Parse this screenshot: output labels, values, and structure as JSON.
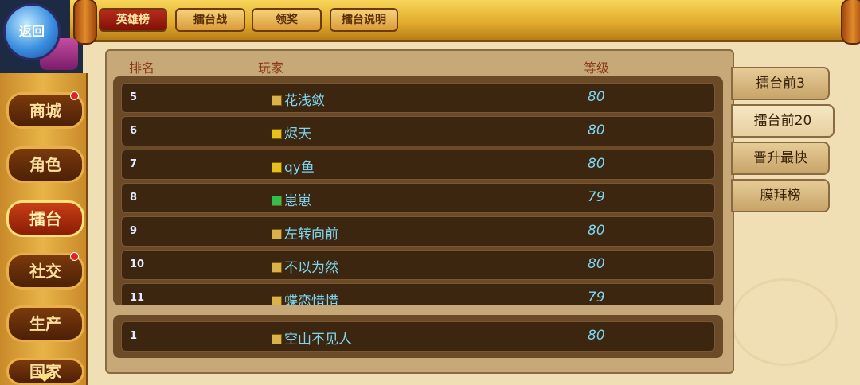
{
  "back_label": "返回",
  "top_tabs": [
    {
      "label": "英雄榜",
      "active": true
    },
    {
      "label": "擂台战",
      "active": false
    },
    {
      "label": "领奖",
      "active": false
    },
    {
      "label": "擂台说明",
      "active": false
    }
  ],
  "sidebar": [
    {
      "label": "商城",
      "badge": true
    },
    {
      "label": "角色",
      "badge": false
    },
    {
      "label": "擂台",
      "badge": false,
      "active": true
    },
    {
      "label": "社交",
      "badge": true
    },
    {
      "label": "生产",
      "badge": false
    },
    {
      "label": "国家",
      "badge": false
    }
  ],
  "columns": {
    "rank": "排名",
    "player": "玩家",
    "level": "等级"
  },
  "rows": [
    {
      "rank": "5",
      "name": "花浅敛",
      "level": "80",
      "flag": "#d9b24a"
    },
    {
      "rank": "6",
      "name": "烬天",
      "level": "80",
      "flag": "#e4c21a"
    },
    {
      "rank": "7",
      "name": "qy鱼",
      "level": "80",
      "flag": "#e4c21a"
    },
    {
      "rank": "8",
      "name": "崽崽",
      "level": "79",
      "flag": "#2fbf4a"
    },
    {
      "rank": "9",
      "name": "左转向前",
      "level": "80",
      "flag": "#d9b24a"
    },
    {
      "rank": "10",
      "name": "不以为然",
      "level": "80",
      "flag": "#d9b24a"
    },
    {
      "rank": "11",
      "name": "蝶恋惜惜",
      "level": "79",
      "flag": "#d9b24a"
    }
  ],
  "self_row": {
    "rank": "1",
    "name": "空山不见人",
    "level": "80",
    "flag": "#d9b24a"
  },
  "right_tabs": [
    {
      "label": "擂台前3",
      "active": false
    },
    {
      "label": "擂台前20",
      "active": true
    },
    {
      "label": "晋升最快",
      "active": false
    },
    {
      "label": "膜拜榜",
      "active": false
    }
  ]
}
